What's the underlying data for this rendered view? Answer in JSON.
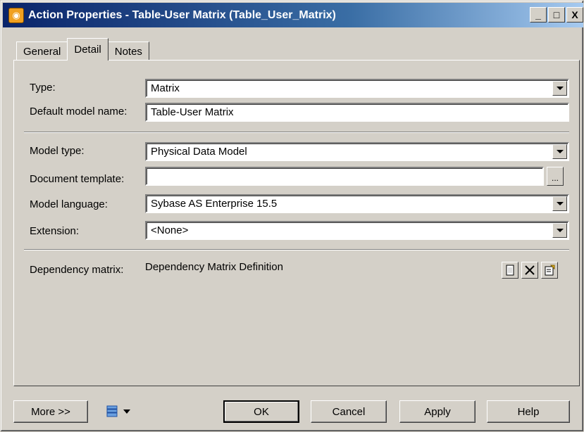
{
  "window": {
    "title": "Action Properties - Table-User Matrix (Table_User_Matrix)",
    "minimize": "_",
    "maximize": "□",
    "close": "X"
  },
  "tabs": [
    {
      "label": "General"
    },
    {
      "label": "Detail"
    },
    {
      "label": "Notes"
    }
  ],
  "form": {
    "type_label": "Type:",
    "type_value": "Matrix",
    "default_model_name_label": "Default model name:",
    "default_model_name_value": "Table-User Matrix",
    "model_type_label": "Model type:",
    "model_type_value": "Physical Data Model",
    "document_template_label": "Document template:",
    "document_template_value": "",
    "document_template_browse": "...",
    "model_language_label": "Model language:",
    "model_language_value": "Sybase AS Enterprise 15.5",
    "extension_label": "Extension:",
    "extension_value": "<None>",
    "dependency_matrix_label": "Dependency matrix:",
    "dependency_matrix_value": "Dependency Matrix Definition"
  },
  "icons": {
    "new": "new-icon",
    "delete": "delete-icon",
    "properties": "properties-icon",
    "print": "print-icon"
  },
  "buttons": {
    "more": "More >>",
    "ok": "OK",
    "cancel": "Cancel",
    "apply": "Apply",
    "help": "Help"
  }
}
